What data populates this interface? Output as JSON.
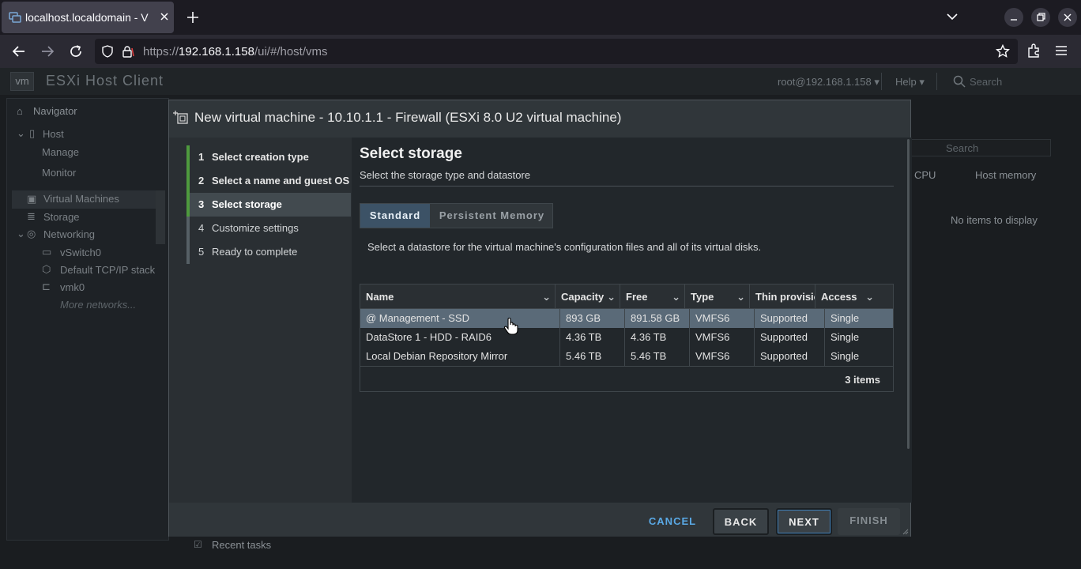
{
  "browser": {
    "tab_title": "localhost.localdomain - V",
    "url_prefix": "https://",
    "url_host": "192.168.1.158",
    "url_path": "/ui/#/host/vms"
  },
  "esxi": {
    "brand": "ESXi Host Client",
    "logo": "vm",
    "user": "root@192.168.1.158",
    "help": "Help",
    "search_placeholder": "Search",
    "navigator": {
      "title": "Navigator",
      "host": "Host",
      "manage": "Manage",
      "monitor": "Monitor",
      "virtual_machines": "Virtual Machines",
      "storage": "Storage",
      "networking": "Networking",
      "vswitch": "vSwitch0",
      "tcpip": "Default TCP/IP stack",
      "vmk": "vmk0",
      "more": "More networks..."
    },
    "bg_search": "Search",
    "bg_cols": {
      "cpu": "CPU",
      "host_memory": "Host memory"
    },
    "bg_empty": "No items to display",
    "recent_tasks": "Recent tasks"
  },
  "modal": {
    "title": "New virtual machine - 10.10.1.1 - Firewall (ESXi 8.0 U2 virtual machine)",
    "steps": [
      {
        "num": "1",
        "label": "Select creation type"
      },
      {
        "num": "2",
        "label": "Select a name and guest OS"
      },
      {
        "num": "3",
        "label": "Select storage"
      },
      {
        "num": "4",
        "label": "Customize settings"
      },
      {
        "num": "5",
        "label": "Ready to complete"
      }
    ],
    "heading": "Select storage",
    "subheading": "Select the storage type and datastore",
    "tabs": {
      "standard": "Standard",
      "persistent": "Persistent Memory"
    },
    "description": "Select a datastore for the virtual machine's configuration files and all of its virtual disks.",
    "table": {
      "columns": [
        "Name",
        "Capacity",
        "Free",
        "Type",
        "Thin provisioning",
        "Access"
      ],
      "rows": [
        [
          "@ Management - SSD",
          "893 GB",
          "891.58 GB",
          "VMFS6",
          "Supported",
          "Single"
        ],
        [
          "DataStore 1 - HDD - RAID6",
          "4.36 TB",
          "4.36 TB",
          "VMFS6",
          "Supported",
          "Single"
        ],
        [
          "Local Debian Repository Mirror",
          "5.46 TB",
          "5.46 TB",
          "VMFS6",
          "Supported",
          "Single"
        ]
      ],
      "item_count": "3 items"
    },
    "buttons": {
      "cancel": "CANCEL",
      "back": "BACK",
      "next": "NEXT",
      "finish": "FINISH"
    }
  }
}
